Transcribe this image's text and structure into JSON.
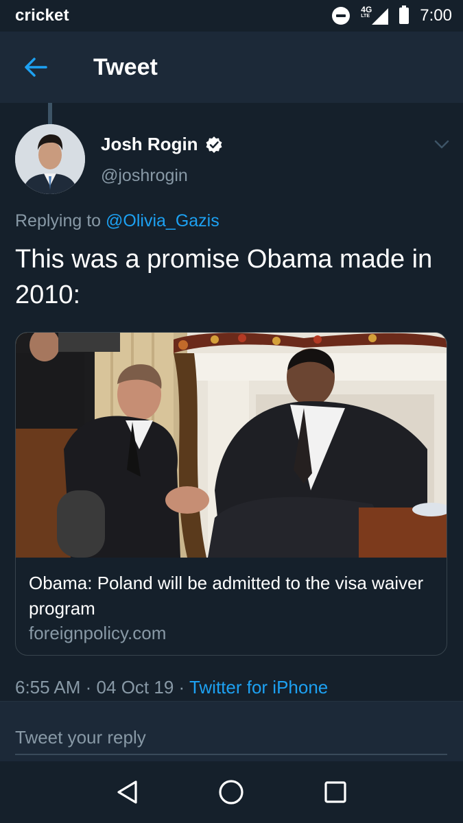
{
  "status_bar": {
    "carrier": "cricket",
    "network_label": "4G",
    "network_sub": "LTE",
    "time": "7:00",
    "icons": [
      "do-not-disturb-icon",
      "signal-icon",
      "battery-icon"
    ]
  },
  "header": {
    "title": "Tweet",
    "back_icon": "arrow-left-icon",
    "accent_color": "#1da1f2"
  },
  "tweet": {
    "author_name": "Josh Rogin",
    "author_handle": "@joshrogin",
    "verified": true,
    "replying_prefix": "Replying to",
    "replying_to": "@Olivia_Gazis",
    "text": "This was a promise Obama made in 2010:",
    "card": {
      "title": "Obama: Poland will be admitted to the visa waiver program",
      "domain": "foreignpolicy.com"
    },
    "time": "6:55 AM",
    "separator": "·",
    "date": "04 Oct 19",
    "source": "Twitter for iPhone"
  },
  "reply": {
    "placeholder": "Tweet your reply"
  },
  "nav": {
    "back_icon": "triangle-back-icon",
    "home_icon": "circle-home-icon",
    "recents_icon": "square-recents-icon"
  },
  "colors": {
    "background": "#15202b",
    "header_bg": "#1c2938",
    "secondary_text": "#8899a6",
    "link": "#1da1f2"
  }
}
